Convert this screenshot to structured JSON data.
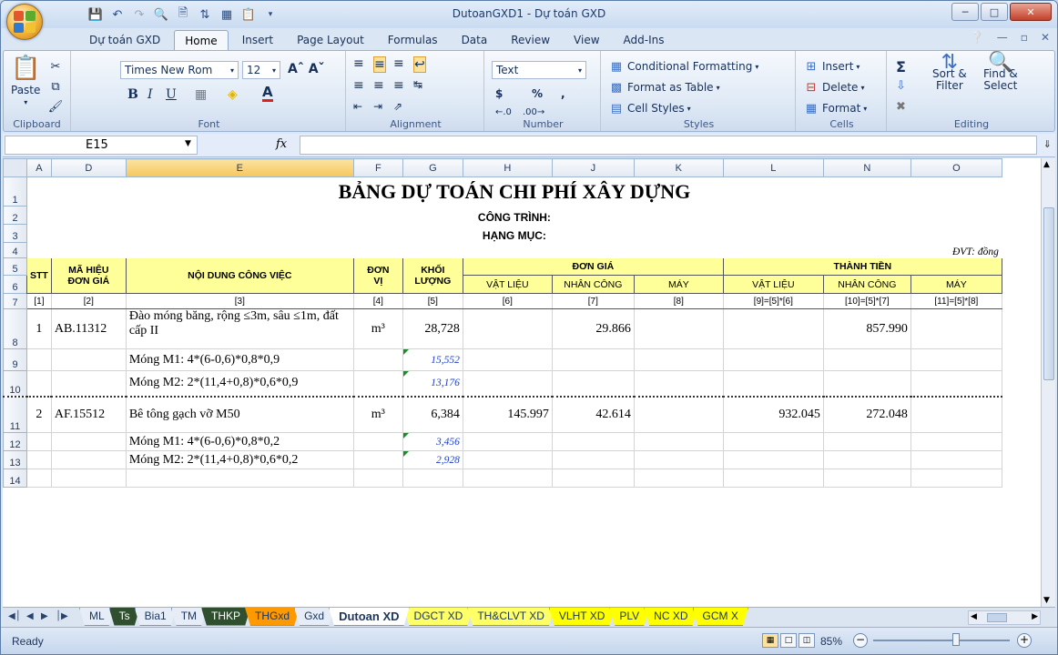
{
  "window": {
    "title": "DutoanGXD1 - Dự toán GXD"
  },
  "ribbon_tabs": [
    "Dự toán GXD",
    "Home",
    "Insert",
    "Page Layout",
    "Formulas",
    "Data",
    "Review",
    "View",
    "Add-Ins"
  ],
  "clipboard": {
    "paste": "Paste",
    "label": "Clipboard"
  },
  "font": {
    "name": "Times New Rom",
    "size": "12",
    "label": "Font"
  },
  "alignment": {
    "label": "Alignment"
  },
  "number": {
    "format": "Text",
    "currency": "$",
    "percent": "%",
    "comma": ",",
    "label": "Number"
  },
  "styles": {
    "conditional": "Conditional Formatting",
    "format_table": "Format as Table",
    "cell_styles": "Cell Styles",
    "label": "Styles"
  },
  "cells": {
    "insert": "Insert",
    "delete": "Delete",
    "format": "Format",
    "label": "Cells"
  },
  "editing": {
    "sort": "Sort &",
    "sort2": "Filter",
    "find": "Find &",
    "find2": "Select",
    "label": "Editing"
  },
  "formula_bar": {
    "name_box": "E15",
    "fx": "fx",
    "content": ""
  },
  "columns": [
    "A",
    "D",
    "E",
    "F",
    "G",
    "H",
    "J",
    "K",
    "L",
    "N",
    "O"
  ],
  "sheet": {
    "title": "BẢNG DỰ TOÁN CHI PHÍ XÂY DỰNG",
    "cong_trinh": "CÔNG TRÌNH:",
    "hang_muc": "HẠNG MỤC:",
    "dvt": "ĐVT: đồng",
    "h_stt": "STT",
    "h_ma1": "MÃ HIỆU",
    "h_ma2": "ĐƠN GIÁ",
    "h_nd": "NỘI DUNG CÔNG VIỆC",
    "h_dv1": "ĐƠN",
    "h_dv2": "VỊ",
    "h_kl1": "KHỐI",
    "h_kl2": "LƯỢNG",
    "h_dongia": "ĐƠN GIÁ",
    "h_thanhtien": "THÀNH TIỀN",
    "h_vl": "VẬT LIỆU",
    "h_nc": "NHÂN CÔNG",
    "h_may": "MÁY",
    "refs": [
      "[1]",
      "[2]",
      "[3]",
      "[4]",
      "[5]",
      "[6]",
      "[7]",
      "[8]",
      "[9]=[5]*[6]",
      "[10]=[5]*[7]",
      "[11]=[5]*[8]"
    ],
    "r8": {
      "stt": "1",
      "ma": "AB.11312",
      "nd": "Đào móng băng, rộng ≤3m, sâu ≤1m, đất cấp II",
      "dv": "m³",
      "kl": "28,728",
      "nc": "29.866",
      "tt_nc": "857.990"
    },
    "r9": {
      "nd": "Móng M1: 4*(6-0,6)*0,8*0,9",
      "kl": "15,552"
    },
    "r10": {
      "nd": "Móng M2: 2*(11,4+0,8)*0,6*0,9",
      "kl": "13,176"
    },
    "r11": {
      "stt": "2",
      "ma": "AF.15512",
      "nd": "Bê tông gạch vỡ M50",
      "dv": "m³",
      "kl": "6,384",
      "vl": "145.997",
      "nc": "42.614",
      "tt_vl": "932.045",
      "tt_nc": "272.048"
    },
    "r12": {
      "nd": "Móng M1: 4*(6-0,6)*0,8*0,2",
      "kl": "3,456"
    },
    "r13": {
      "nd": "Móng M2: 2*(11,4+0,8)*0,6*0,2",
      "kl": "2,928"
    }
  },
  "row_numbers": [
    "1",
    "2",
    "3",
    "4",
    "5",
    "6",
    "7",
    "8",
    "9",
    "10",
    "11",
    "12",
    "13",
    "14"
  ],
  "sheet_tabs": [
    "ML",
    "Ts",
    "Bia1",
    "TM",
    "THKP",
    "THGxd",
    "Gxd",
    "Dutoan XD",
    "DGCT XD",
    "TH&CLVT XD",
    "VLHT XD",
    "PLV",
    "NC XD",
    "GCM X"
  ],
  "status": {
    "ready": "Ready",
    "zoom": "85%"
  }
}
